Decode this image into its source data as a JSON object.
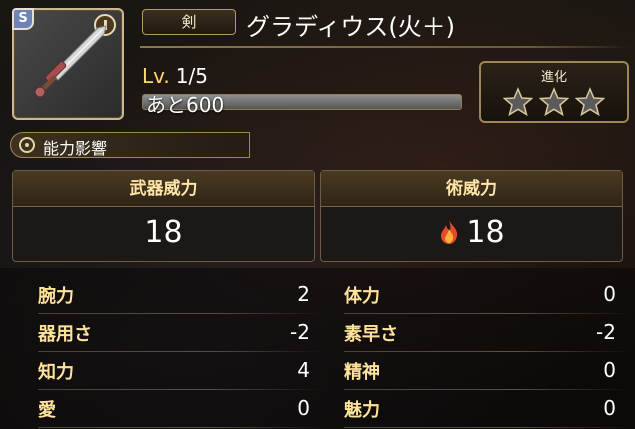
{
  "weapon": {
    "badge": "S",
    "category": "剣",
    "name": "グラディウス(火＋)",
    "level_prefix": "Lv.",
    "level": "1/5",
    "exp_text": "あと600",
    "exp_progress": 0
  },
  "evolution": {
    "label": "進化",
    "stars_filled": 0,
    "stars_total": 3
  },
  "section": {
    "title": "能力影響"
  },
  "power": {
    "physical_label": "武器威力",
    "physical_value": "18",
    "magic_label": "術威力",
    "magic_value": "18",
    "magic_element_icon": "fire-icon"
  },
  "stats_left": [
    {
      "label": "腕力",
      "value": "2"
    },
    {
      "label": "器用さ",
      "value": "-2"
    },
    {
      "label": "知力",
      "value": "4"
    },
    {
      "label": "愛",
      "value": "0"
    }
  ],
  "stats_right": [
    {
      "label": "体力",
      "value": "0"
    },
    {
      "label": "素早さ",
      "value": "-2"
    },
    {
      "label": "精神",
      "value": "0"
    },
    {
      "label": "魅力",
      "value": "0"
    }
  ],
  "colors": {
    "gold": "#ffe39a",
    "frame": "#b59a63",
    "background": "#14110e"
  }
}
